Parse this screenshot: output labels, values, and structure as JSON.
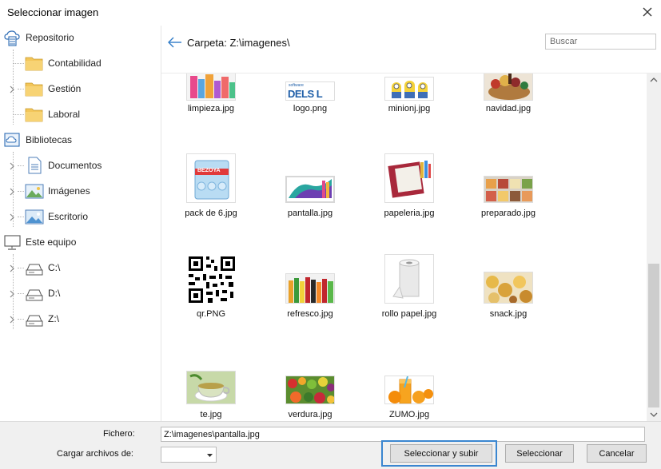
{
  "dialog": {
    "title": "Seleccionar imagen"
  },
  "tree": {
    "repository": {
      "label": "Repositorio",
      "children": [
        {
          "label": "Contabilidad"
        },
        {
          "label": "Gestión"
        },
        {
          "label": "Laboral"
        }
      ]
    },
    "libraries": {
      "label": "Bibliotecas",
      "children": [
        {
          "label": "Documentos"
        },
        {
          "label": "Imágenes"
        },
        {
          "label": "Escritorio"
        }
      ]
    },
    "computer": {
      "label": "Este equipo",
      "children": [
        {
          "label": "C:\\"
        },
        {
          "label": "D:\\"
        },
        {
          "label": "Z:\\"
        }
      ]
    }
  },
  "header": {
    "folder_path": "Carpeta: Z:\\imagenes\\",
    "search_placeholder": "Buscar"
  },
  "files": [
    {
      "name": "limpieza.jpg",
      "thumb": "cleaning-products"
    },
    {
      "name": "logo.png",
      "thumb": "delsol-logo",
      "logo_text": "DELS L",
      "logo_small": "software"
    },
    {
      "name": "minionj.jpg",
      "thumb": "minions"
    },
    {
      "name": "navidad.jpg",
      "thumb": "christmas-basket"
    },
    {
      "name": "pack de 6.jpg",
      "thumb": "water-pack",
      "brand": "BEZOYA"
    },
    {
      "name": "pantalla.jpg",
      "thumb": "screen-wave"
    },
    {
      "name": "papeleria.jpg",
      "thumb": "stationery-folder"
    },
    {
      "name": "preparado.jpg",
      "thumb": "prepared-food"
    },
    {
      "name": "qr.PNG",
      "thumb": "qr-code"
    },
    {
      "name": "refresco.jpg",
      "thumb": "soft-drinks"
    },
    {
      "name": "rollo papel.jpg",
      "thumb": "paper-roll"
    },
    {
      "name": "snack.jpg",
      "thumb": "snacks"
    },
    {
      "name": "te.jpg",
      "thumb": "tea-cup"
    },
    {
      "name": "verdura.jpg",
      "thumb": "vegetables"
    },
    {
      "name": "ZUMO.jpg",
      "thumb": "orange-juice"
    }
  ],
  "footer": {
    "filename_label": "Fichero:",
    "filename_value": "Z:\\imagenes\\pantalla.jpg",
    "load_label": "Cargar archivos de:",
    "load_value": "",
    "buttons": {
      "select_upload": "Seleccionar y subir",
      "select": "Seleccionar",
      "cancel": "Cancelar"
    }
  },
  "colors": {
    "accent": "#3a86d0",
    "folder": "#f3c65a",
    "button_bg": "#e1e1e1",
    "footer_bg": "#f0f0f0"
  }
}
